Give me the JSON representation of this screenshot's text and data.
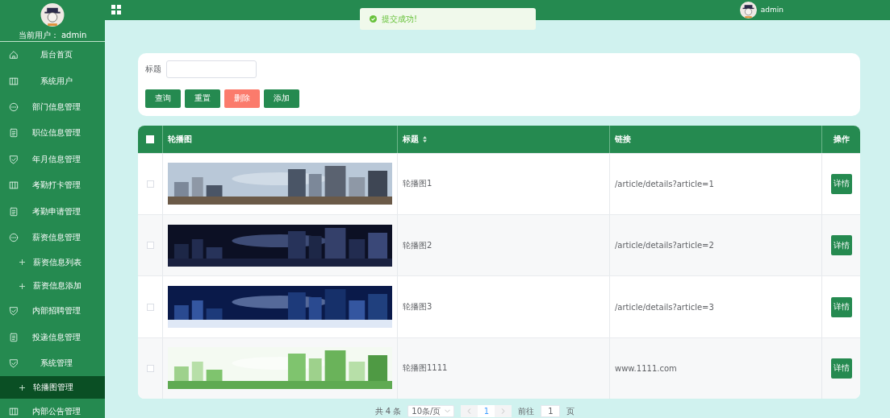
{
  "sidebar": {
    "user_label": "当前用户：",
    "user_name": "admin",
    "items": [
      {
        "label": "后台首页",
        "kind": "home",
        "selected": false
      },
      {
        "label": "系统用户",
        "kind": "columns",
        "selected": false
      },
      {
        "label": "部门信息管理",
        "kind": "chat",
        "selected": false
      },
      {
        "label": "职位信息管理",
        "kind": "doc",
        "selected": false
      },
      {
        "label": "年月信息管理",
        "kind": "shield",
        "selected": false
      },
      {
        "label": "考勤打卡管理",
        "kind": "columns",
        "selected": false
      },
      {
        "label": "考勤申请管理",
        "kind": "doc",
        "selected": false
      },
      {
        "label": "薪资信息管理",
        "kind": "chat",
        "selected": false,
        "children": [
          {
            "label": "薪资信息列表",
            "selected": false
          },
          {
            "label": "薪资信息添加",
            "selected": false
          }
        ]
      },
      {
        "label": "内部招聘管理",
        "kind": "shield",
        "selected": false
      },
      {
        "label": "投递信息管理",
        "kind": "doc",
        "selected": false
      },
      {
        "label": "系统管理",
        "kind": "shield",
        "selected": false,
        "children": [
          {
            "label": "轮播图管理",
            "selected": true
          }
        ]
      },
      {
        "label": "内部公告管理",
        "kind": "columns",
        "selected": false
      }
    ]
  },
  "header": {
    "user_name": "admin"
  },
  "toast": {
    "message": "提交成功!"
  },
  "search": {
    "label": "标题",
    "buttons": [
      {
        "label": "查询",
        "kind": "primary"
      },
      {
        "label": "重置",
        "kind": "primary"
      },
      {
        "label": "删除",
        "kind": "danger"
      },
      {
        "label": "添加",
        "kind": "primary"
      }
    ]
  },
  "table": {
    "columns": [
      "轮播图",
      "标题",
      "链接",
      "操作"
    ],
    "all_checked": false,
    "rows": [
      {
        "checked": false,
        "title": "轮播图1",
        "link": "/article/details?article=1",
        "action": "详情"
      },
      {
        "checked": false,
        "title": "轮播图2",
        "link": "/article/details?article=2",
        "action": "详情"
      },
      {
        "checked": false,
        "title": "轮播图3",
        "link": "/article/details?article=3",
        "action": "详情"
      },
      {
        "checked": false,
        "title": "轮播图1111",
        "link": "www.1111.com",
        "action": "详情"
      }
    ]
  },
  "pagination": {
    "total": "共 4 条",
    "page_size": "10条/页",
    "current_page": "1",
    "goto_label": "前往",
    "goto_value": "1",
    "page_unit": "页"
  }
}
